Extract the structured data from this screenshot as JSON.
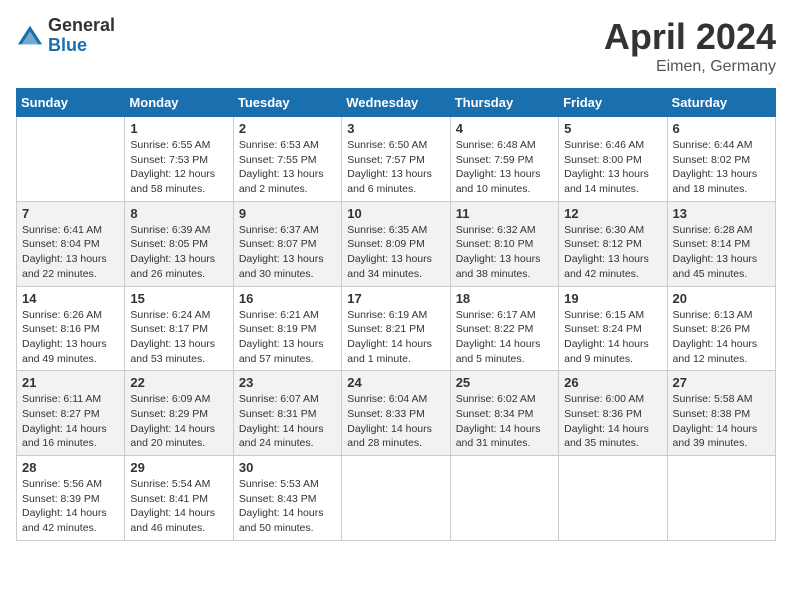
{
  "header": {
    "logo_general": "General",
    "logo_blue": "Blue",
    "month_year": "April 2024",
    "location": "Eimen, Germany"
  },
  "weekdays": [
    "Sunday",
    "Monday",
    "Tuesday",
    "Wednesday",
    "Thursday",
    "Friday",
    "Saturday"
  ],
  "weeks": [
    [
      {
        "day": "",
        "sunrise": "",
        "sunset": "",
        "daylight": "",
        "empty": true
      },
      {
        "day": "1",
        "sunrise": "Sunrise: 6:55 AM",
        "sunset": "Sunset: 7:53 PM",
        "daylight": "Daylight: 12 hours and 58 minutes."
      },
      {
        "day": "2",
        "sunrise": "Sunrise: 6:53 AM",
        "sunset": "Sunset: 7:55 PM",
        "daylight": "Daylight: 13 hours and 2 minutes."
      },
      {
        "day": "3",
        "sunrise": "Sunrise: 6:50 AM",
        "sunset": "Sunset: 7:57 PM",
        "daylight": "Daylight: 13 hours and 6 minutes."
      },
      {
        "day": "4",
        "sunrise": "Sunrise: 6:48 AM",
        "sunset": "Sunset: 7:59 PM",
        "daylight": "Daylight: 13 hours and 10 minutes."
      },
      {
        "day": "5",
        "sunrise": "Sunrise: 6:46 AM",
        "sunset": "Sunset: 8:00 PM",
        "daylight": "Daylight: 13 hours and 14 minutes."
      },
      {
        "day": "6",
        "sunrise": "Sunrise: 6:44 AM",
        "sunset": "Sunset: 8:02 PM",
        "daylight": "Daylight: 13 hours and 18 minutes."
      }
    ],
    [
      {
        "day": "7",
        "sunrise": "Sunrise: 6:41 AM",
        "sunset": "Sunset: 8:04 PM",
        "daylight": "Daylight: 13 hours and 22 minutes."
      },
      {
        "day": "8",
        "sunrise": "Sunrise: 6:39 AM",
        "sunset": "Sunset: 8:05 PM",
        "daylight": "Daylight: 13 hours and 26 minutes."
      },
      {
        "day": "9",
        "sunrise": "Sunrise: 6:37 AM",
        "sunset": "Sunset: 8:07 PM",
        "daylight": "Daylight: 13 hours and 30 minutes."
      },
      {
        "day": "10",
        "sunrise": "Sunrise: 6:35 AM",
        "sunset": "Sunset: 8:09 PM",
        "daylight": "Daylight: 13 hours and 34 minutes."
      },
      {
        "day": "11",
        "sunrise": "Sunrise: 6:32 AM",
        "sunset": "Sunset: 8:10 PM",
        "daylight": "Daylight: 13 hours and 38 minutes."
      },
      {
        "day": "12",
        "sunrise": "Sunrise: 6:30 AM",
        "sunset": "Sunset: 8:12 PM",
        "daylight": "Daylight: 13 hours and 42 minutes."
      },
      {
        "day": "13",
        "sunrise": "Sunrise: 6:28 AM",
        "sunset": "Sunset: 8:14 PM",
        "daylight": "Daylight: 13 hours and 45 minutes."
      }
    ],
    [
      {
        "day": "14",
        "sunrise": "Sunrise: 6:26 AM",
        "sunset": "Sunset: 8:16 PM",
        "daylight": "Daylight: 13 hours and 49 minutes."
      },
      {
        "day": "15",
        "sunrise": "Sunrise: 6:24 AM",
        "sunset": "Sunset: 8:17 PM",
        "daylight": "Daylight: 13 hours and 53 minutes."
      },
      {
        "day": "16",
        "sunrise": "Sunrise: 6:21 AM",
        "sunset": "Sunset: 8:19 PM",
        "daylight": "Daylight: 13 hours and 57 minutes."
      },
      {
        "day": "17",
        "sunrise": "Sunrise: 6:19 AM",
        "sunset": "Sunset: 8:21 PM",
        "daylight": "Daylight: 14 hours and 1 minute."
      },
      {
        "day": "18",
        "sunrise": "Sunrise: 6:17 AM",
        "sunset": "Sunset: 8:22 PM",
        "daylight": "Daylight: 14 hours and 5 minutes."
      },
      {
        "day": "19",
        "sunrise": "Sunrise: 6:15 AM",
        "sunset": "Sunset: 8:24 PM",
        "daylight": "Daylight: 14 hours and 9 minutes."
      },
      {
        "day": "20",
        "sunrise": "Sunrise: 6:13 AM",
        "sunset": "Sunset: 8:26 PM",
        "daylight": "Daylight: 14 hours and 12 minutes."
      }
    ],
    [
      {
        "day": "21",
        "sunrise": "Sunrise: 6:11 AM",
        "sunset": "Sunset: 8:27 PM",
        "daylight": "Daylight: 14 hours and 16 minutes."
      },
      {
        "day": "22",
        "sunrise": "Sunrise: 6:09 AM",
        "sunset": "Sunset: 8:29 PM",
        "daylight": "Daylight: 14 hours and 20 minutes."
      },
      {
        "day": "23",
        "sunrise": "Sunrise: 6:07 AM",
        "sunset": "Sunset: 8:31 PM",
        "daylight": "Daylight: 14 hours and 24 minutes."
      },
      {
        "day": "24",
        "sunrise": "Sunrise: 6:04 AM",
        "sunset": "Sunset: 8:33 PM",
        "daylight": "Daylight: 14 hours and 28 minutes."
      },
      {
        "day": "25",
        "sunrise": "Sunrise: 6:02 AM",
        "sunset": "Sunset: 8:34 PM",
        "daylight": "Daylight: 14 hours and 31 minutes."
      },
      {
        "day": "26",
        "sunrise": "Sunrise: 6:00 AM",
        "sunset": "Sunset: 8:36 PM",
        "daylight": "Daylight: 14 hours and 35 minutes."
      },
      {
        "day": "27",
        "sunrise": "Sunrise: 5:58 AM",
        "sunset": "Sunset: 8:38 PM",
        "daylight": "Daylight: 14 hours and 39 minutes."
      }
    ],
    [
      {
        "day": "28",
        "sunrise": "Sunrise: 5:56 AM",
        "sunset": "Sunset: 8:39 PM",
        "daylight": "Daylight: 14 hours and 42 minutes."
      },
      {
        "day": "29",
        "sunrise": "Sunrise: 5:54 AM",
        "sunset": "Sunset: 8:41 PM",
        "daylight": "Daylight: 14 hours and 46 minutes."
      },
      {
        "day": "30",
        "sunrise": "Sunrise: 5:53 AM",
        "sunset": "Sunset: 8:43 PM",
        "daylight": "Daylight: 14 hours and 50 minutes."
      },
      {
        "day": "",
        "sunrise": "",
        "sunset": "",
        "daylight": "",
        "empty": true
      },
      {
        "day": "",
        "sunrise": "",
        "sunset": "",
        "daylight": "",
        "empty": true
      },
      {
        "day": "",
        "sunrise": "",
        "sunset": "",
        "daylight": "",
        "empty": true
      },
      {
        "day": "",
        "sunrise": "",
        "sunset": "",
        "daylight": "",
        "empty": true
      }
    ]
  ]
}
